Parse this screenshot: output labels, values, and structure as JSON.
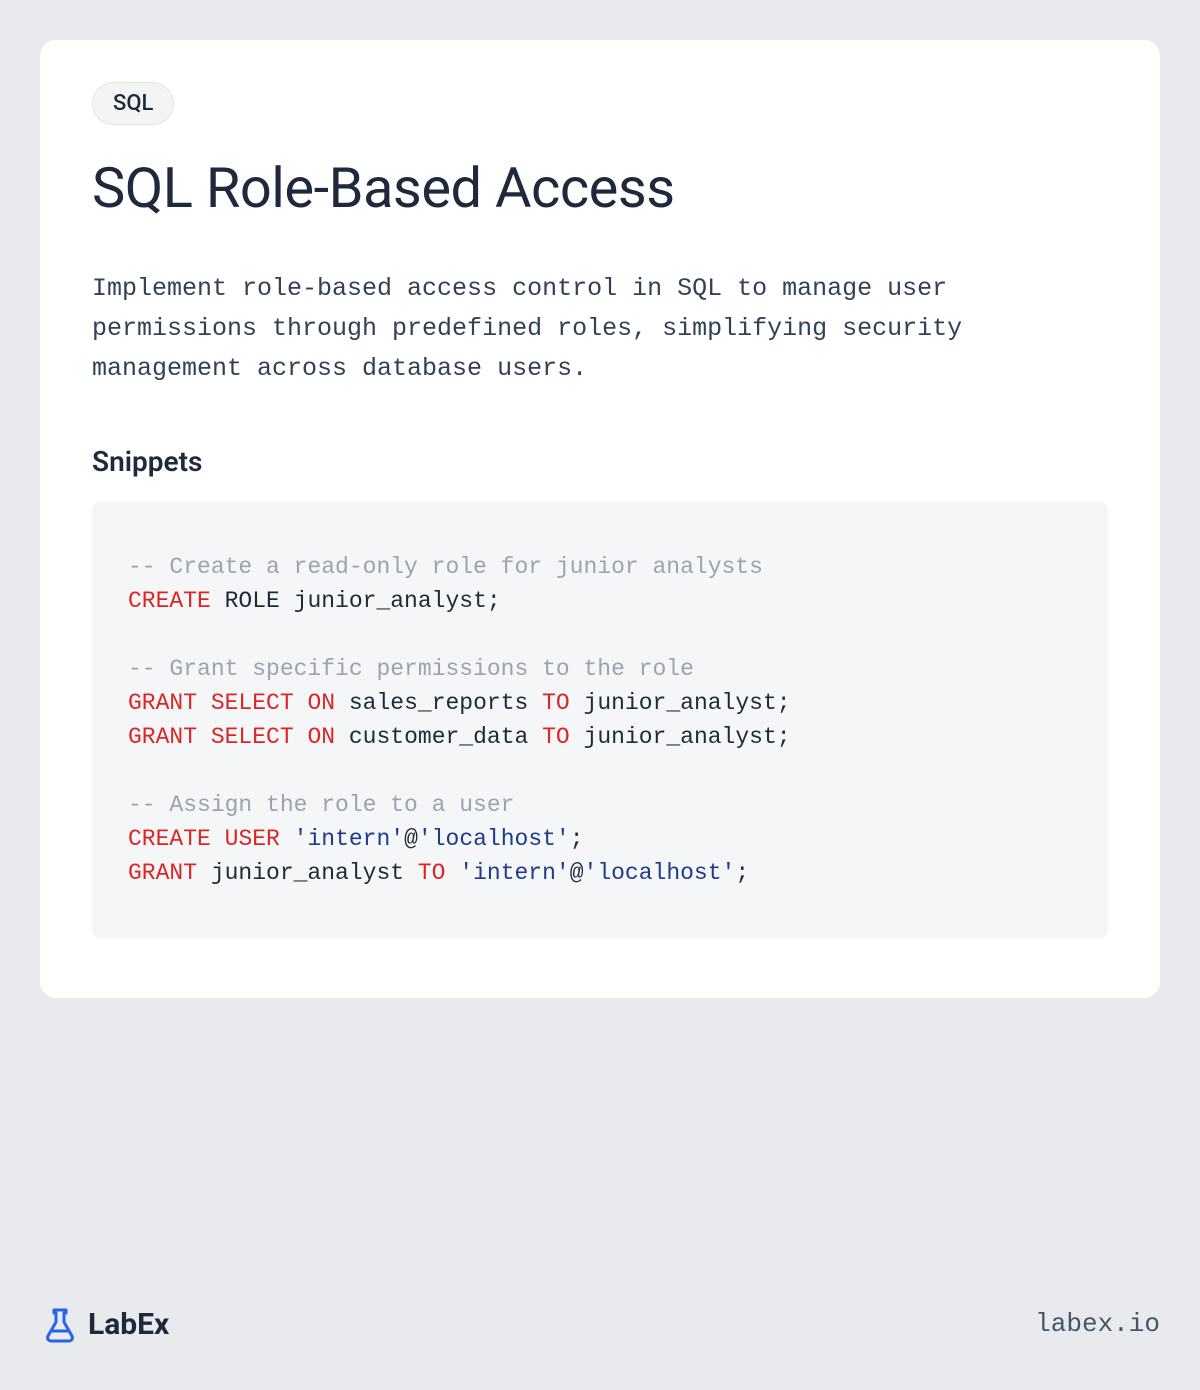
{
  "badge": "SQL",
  "title": "SQL Role-Based Access",
  "description": "Implement role-based access control in SQL to manage user permissions through predefined roles, simplifying security management across database users.",
  "section_header": "Snippets",
  "code": {
    "lines": [
      {
        "type": "comment",
        "text": "-- Create a read-only role for junior analysts"
      },
      {
        "type": "code",
        "tokens": [
          {
            "t": "keyword",
            "v": "CREATE"
          },
          {
            "t": "plain",
            "v": " ROLE junior_analyst;"
          }
        ]
      },
      {
        "type": "blank"
      },
      {
        "type": "comment",
        "text": "-- Grant specific permissions to the role"
      },
      {
        "type": "code",
        "tokens": [
          {
            "t": "keyword",
            "v": "GRANT"
          },
          {
            "t": "plain",
            "v": " "
          },
          {
            "t": "keyword",
            "v": "SELECT"
          },
          {
            "t": "plain",
            "v": " "
          },
          {
            "t": "keyword",
            "v": "ON"
          },
          {
            "t": "plain",
            "v": " sales_reports "
          },
          {
            "t": "keyword",
            "v": "TO"
          },
          {
            "t": "plain",
            "v": " junior_analyst;"
          }
        ]
      },
      {
        "type": "code",
        "tokens": [
          {
            "t": "keyword",
            "v": "GRANT"
          },
          {
            "t": "plain",
            "v": " "
          },
          {
            "t": "keyword",
            "v": "SELECT"
          },
          {
            "t": "plain",
            "v": " "
          },
          {
            "t": "keyword",
            "v": "ON"
          },
          {
            "t": "plain",
            "v": " customer_data "
          },
          {
            "t": "keyword",
            "v": "TO"
          },
          {
            "t": "plain",
            "v": " junior_analyst;"
          }
        ]
      },
      {
        "type": "blank"
      },
      {
        "type": "comment",
        "text": "-- Assign the role to a user"
      },
      {
        "type": "code",
        "tokens": [
          {
            "t": "keyword",
            "v": "CREATE"
          },
          {
            "t": "plain",
            "v": " "
          },
          {
            "t": "keyword",
            "v": "USER"
          },
          {
            "t": "plain",
            "v": " "
          },
          {
            "t": "string",
            "v": "'intern'"
          },
          {
            "t": "plain",
            "v": "@"
          },
          {
            "t": "string",
            "v": "'localhost'"
          },
          {
            "t": "plain",
            "v": ";"
          }
        ]
      },
      {
        "type": "code",
        "tokens": [
          {
            "t": "keyword",
            "v": "GRANT"
          },
          {
            "t": "plain",
            "v": " junior_analyst "
          },
          {
            "t": "keyword",
            "v": "TO"
          },
          {
            "t": "plain",
            "v": " "
          },
          {
            "t": "string",
            "v": "'intern'"
          },
          {
            "t": "plain",
            "v": "@"
          },
          {
            "t": "string",
            "v": "'localhost'"
          },
          {
            "t": "plain",
            "v": ";"
          }
        ]
      }
    ]
  },
  "footer": {
    "logo_text": "LabEx",
    "link": "labex.io"
  }
}
